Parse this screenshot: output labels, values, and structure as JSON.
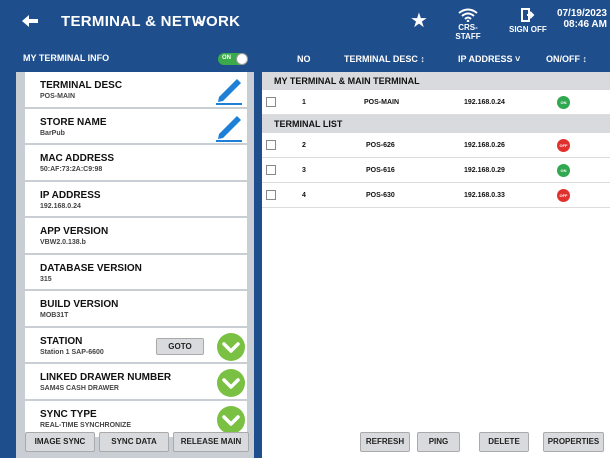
{
  "header": {
    "title": "TERMINAL & NETWORK",
    "wifi_label": "CRS-STAFF",
    "signoff_label": "SIGN OFF",
    "date": "07/19/2023",
    "time": "08:46 AM"
  },
  "left_panel": {
    "title": "MY TERMINAL INFO",
    "toggle_label": "ON",
    "items": [
      {
        "label": "TERMINAL DESC",
        "value": "POS-MAIN"
      },
      {
        "label": "STORE NAME",
        "value": "BarPub"
      },
      {
        "label": "MAC ADDRESS",
        "value": "50:AF:73:2A:C9:98"
      },
      {
        "label": "IP ADDRESS",
        "value": "192.168.0.24"
      },
      {
        "label": "APP VERSION",
        "value": "VBW2.0.138.b"
      },
      {
        "label": "DATABASE VERSION",
        "value": "315"
      },
      {
        "label": "BUILD VERSION",
        "value": "MOB31T"
      },
      {
        "label": "STATION",
        "value": "Station 1 SAP-6600"
      },
      {
        "label": "LINKED DRAWER NUMBER",
        "value": "SAM4S CASH DRAWER"
      },
      {
        "label": "SYNC TYPE",
        "value": "REAL-TIME SYNCHRONIZE"
      }
    ],
    "goto_label": "GOTO",
    "buttons": {
      "image_sync": "IMAGE SYNC",
      "sync_data": "SYNC DATA",
      "release_main": "RELEASE MAIN"
    }
  },
  "right_panel": {
    "columns": {
      "no": "NO",
      "desc": "TERMINAL DESC ↕",
      "ip": "IP ADDRESS ˅",
      "onoff": "ON/OFF ↕"
    },
    "section_main": "MY TERMINAL & MAIN TERMINAL",
    "section_list": "TERMINAL LIST",
    "main_rows": [
      {
        "no": "1",
        "desc": "POS-MAIN",
        "ip": "192.168.0.24",
        "status": "ON"
      }
    ],
    "list_rows": [
      {
        "no": "2",
        "desc": "POS-626",
        "ip": "192.168.0.26",
        "status": "OFF"
      },
      {
        "no": "3",
        "desc": "POS-616",
        "ip": "192.168.0.29",
        "status": "ON"
      },
      {
        "no": "4",
        "desc": "POS-630",
        "ip": "192.168.0.33",
        "status": "OFF"
      }
    ],
    "buttons": {
      "refresh": "REFRESH",
      "ping": "PING",
      "delete": "DELETE",
      "properties": "PROPERTIES"
    }
  },
  "colors": {
    "header_bg": "#1f4e8c",
    "status_on": "#2fa84f",
    "status_off": "#e0312e",
    "edit_pencil": "#1e7fd6",
    "confirm_check": "#7ac143"
  }
}
